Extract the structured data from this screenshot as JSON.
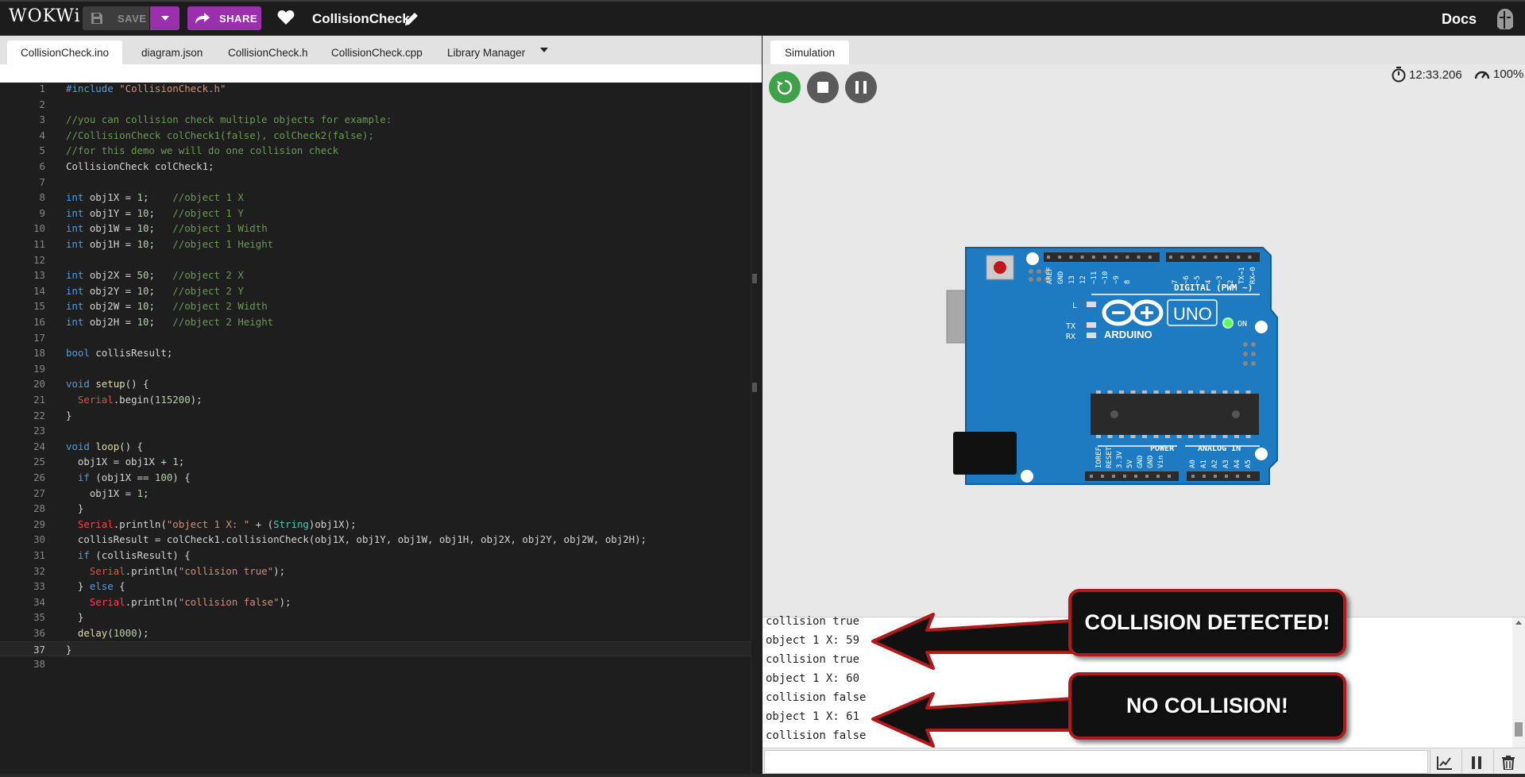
{
  "header": {
    "logo": "WOKWi",
    "save_label": "SAVE",
    "share_label": "SHARE",
    "project_title": "CollisionCheck",
    "docs_label": "Docs"
  },
  "editor": {
    "tabs": [
      {
        "label": "CollisionCheck.ino",
        "active": true
      },
      {
        "label": "diagram.json"
      },
      {
        "label": "CollisionCheck.h"
      },
      {
        "label": "CollisionCheck.cpp"
      },
      {
        "label": "Library Manager"
      }
    ],
    "current_line": 37
  },
  "code": [
    "#include \"CollisionCheck.h\"",
    "",
    "//you can collision check multiple objects for example:",
    "//CollisionCheck colCheck1(false), colCheck2(false);",
    "//for this demo we will do one collision check",
    "CollisionCheck colCheck1;",
    "",
    "int obj1X = 1;    //object 1 X",
    "int obj1Y = 10;   //object 1 Y",
    "int obj1W = 10;   //object 1 Width",
    "int obj1H = 10;   //object 1 Height",
    "",
    "int obj2X = 50;   //object 2 X",
    "int obj2Y = 10;   //object 2 Y",
    "int obj2W = 10;   //object 2 Width",
    "int obj2H = 10;   //object 2 Height",
    "",
    "bool collisResult;",
    "",
    "void setup() {",
    "  Serial.begin(115200);",
    "}",
    "",
    "void loop() {",
    "  obj1X = obj1X + 1;",
    "  if (obj1X == 100) {",
    "    obj1X = 1;",
    "  }",
    "  Serial.println(\"object 1 X: \" + (String)obj1X);",
    "  collisResult = colCheck1.collisionCheck(obj1X, obj1Y, obj1W, obj1H, obj2X, obj2Y, obj2W, obj2H);",
    "  if (collisResult) {",
    "    Serial.println(\"collision true\");",
    "  } else {",
    "    Serial.println(\"collision false\");",
    "  }",
    "  delay(1000);",
    "}",
    ""
  ],
  "simulation": {
    "tab_label": "Simulation",
    "timer": "12:33.206",
    "speed": "100%",
    "board": {
      "name": "UNO",
      "brand": "ARDUINO",
      "on_label": "ON",
      "digital_label": "DIGITAL (PWM ~)",
      "power_label": "POWER",
      "analog_label": "ANALOG IN",
      "l_label": "L",
      "tx_label": "TX",
      "rx_label": "RX",
      "top_pins": [
        "AREF",
        "GND",
        "13",
        "12",
        "~11",
        "~10",
        "~9",
        "8",
        "7",
        "~6",
        "~5",
        "4",
        "~3",
        "2",
        "TX→1",
        "RX←0"
      ],
      "power_pins": [
        "IOREF",
        "RESET",
        "3.3V",
        "5V",
        "GND",
        "GND",
        "Vin"
      ],
      "analog_pins": [
        "A0",
        "A1",
        "A2",
        "A3",
        "A4",
        "A5"
      ]
    }
  },
  "serial": {
    "lines": [
      "collision true",
      "object 1 X: 59",
      "collision true",
      "object 1 X: 60",
      "collision false",
      "object 1 X: 61",
      "collision false"
    ],
    "input_value": ""
  },
  "callouts": {
    "first": "COLLISION DETECTED!",
    "second": "NO COLLISION!"
  },
  "colors": {
    "accent_purple": "#9b2fae",
    "run_green": "#3fa24b",
    "board_blue": "#1f7bc1",
    "callout_border": "#b11a1a"
  }
}
